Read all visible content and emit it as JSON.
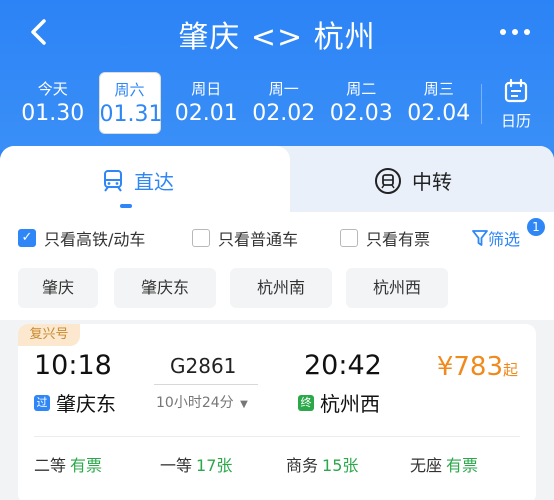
{
  "header": {
    "title": "肇庆 <> 杭州",
    "back_icon": "chevron-left-icon",
    "more_icon": "more-dots-icon"
  },
  "dates": [
    {
      "week": "今天",
      "date": "01.30",
      "selected": false
    },
    {
      "week": "周六",
      "date": "01.31",
      "selected": true
    },
    {
      "week": "周日",
      "date": "02.01",
      "selected": false
    },
    {
      "week": "周一",
      "date": "02.02",
      "selected": false
    },
    {
      "week": "周二",
      "date": "02.03",
      "selected": false
    },
    {
      "week": "周三",
      "date": "02.04",
      "selected": false
    }
  ],
  "calendar": {
    "label": "日历",
    "icon": "calendar-icon"
  },
  "tabs": {
    "direct": {
      "label": "直达",
      "icon": "train-icon"
    },
    "transfer": {
      "label": "中转",
      "icon": "transfer-icon"
    }
  },
  "filters": {
    "only_high_speed": {
      "label": "只看高铁/动车",
      "checked": true
    },
    "only_normal": {
      "label": "只看普通车",
      "checked": false
    },
    "only_available": {
      "label": "只看有票",
      "checked": false
    },
    "screen": {
      "label": "筛选",
      "badge": "1",
      "icon": "filter-icon"
    }
  },
  "stations": [
    "肇庆",
    "肇庆东",
    "杭州南",
    "杭州西"
  ],
  "train": {
    "tag": "复兴号",
    "depart_time": "10:18",
    "train_no": "G2861",
    "arrive_time": "20:42",
    "duration": "10小时24分",
    "price": "¥783",
    "price_suffix": "起",
    "depart_marker": "过",
    "depart_station": "肇庆东",
    "arrive_marker": "终",
    "arrive_station": "杭州西",
    "seats": [
      {
        "class": "二等",
        "avail": "有票"
      },
      {
        "class": "一等",
        "avail": "17张"
      },
      {
        "class": "商务",
        "avail": "15张"
      },
      {
        "class": "无座",
        "avail": "有票"
      }
    ]
  },
  "colors": {
    "primary": "#2f86f6",
    "price": "#f08a1d",
    "available": "#2aa84a",
    "tag_bg": "#fbe8cf"
  }
}
